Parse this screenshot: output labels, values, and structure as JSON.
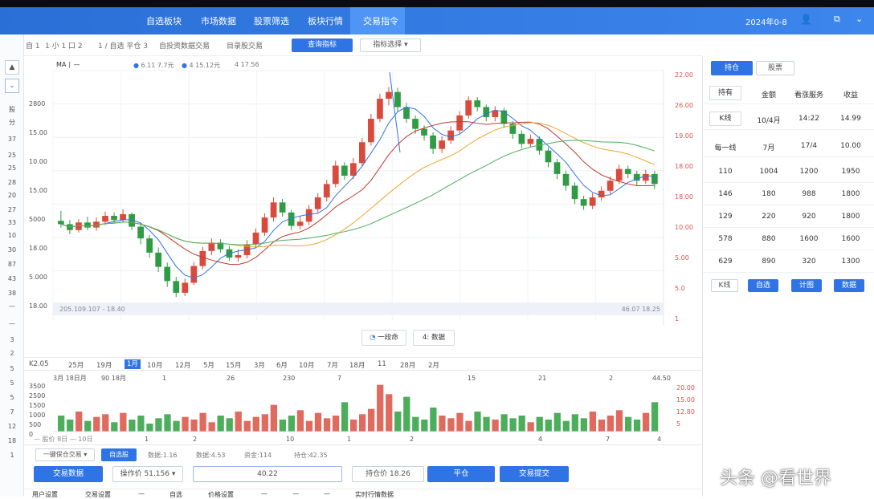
{
  "nav": {
    "items": [
      "自选板块",
      "市场数据",
      "股票筛选",
      "板块行情",
      "交易指令"
    ],
    "active_index": 4,
    "date": "2024年0-8",
    "user_icon": "user-icon",
    "share_icon": "share-icon"
  },
  "toolbar": {
    "crumbs": [
      "自 1",
      "1 小 1 口 2",
      "1 / 自选 平仓 3",
      "自投资数据交易",
      "目录股交易"
    ],
    "primary_btn": "查询指标",
    "dropdown": "指标选择"
  },
  "chart": {
    "legend": [
      "6.11 7.7元",
      "4 15.12元",
      "4 17.56"
    ],
    "legend_colors": [
      "#2f74e4",
      "#d1453b",
      "#f2a431"
    ],
    "left_axis": [
      "2800",
      "15.00",
      "10.00",
      "15.00",
      "5000",
      "18.00",
      "5.000",
      "18.00"
    ],
    "right_axis": [
      "22.00",
      "26.00",
      "19.00",
      "18.00",
      "18.00",
      "10.00",
      "5.00",
      "5.0",
      "1"
    ],
    "info_left": "205.109.107 - 18.40",
    "info_right": "46.07 18.25",
    "btn1": "一段命",
    "btn2": "4: 数据"
  },
  "left_panel": {
    "labels": [
      "股",
      "分",
      "37",
      "25",
      "25",
      "28",
      "20",
      "27",
      "33",
      "10",
      "30",
      "87",
      "43",
      "38",
      "—",
      "—",
      "3",
      "2",
      "5",
      "5",
      "5",
      "7",
      "12",
      "18",
      "1"
    ]
  },
  "periods": [
    "K2.05",
    "25月",
    "19月",
    "1月",
    "10月",
    "12月",
    "5月",
    "15月",
    "3月",
    "6月",
    "10月",
    "7月",
    "18月",
    "11",
    "28月",
    "2月"
  ],
  "period_active": 3,
  "volume": {
    "title": "3月 18日月",
    "marker": "90 18月",
    "top_ticks": [
      "1",
      "26",
      "230",
      "7",
      "15",
      "21",
      "2",
      "44.50"
    ],
    "left_axis": [
      "3500",
      "2500",
      "1500",
      "1000",
      "500",
      "0"
    ],
    "right_axis": [
      "20.00",
      "15.00",
      "12.80",
      "5"
    ],
    "bottom_ticks": [
      "1",
      "2",
      "10",
      "1",
      "2",
      "4",
      "7",
      "4"
    ],
    "legend_text": "— 股价 8日 — 10日"
  },
  "right_panel": {
    "tabs": [
      "持仓",
      "股票"
    ],
    "headers": [
      "持有",
      "金额",
      "看涨服务",
      "收益"
    ],
    "row1": [
      "K线",
      "10/4月",
      "14:22",
      "14.99"
    ],
    "row2": [
      "每一线",
      "7月",
      "17/4",
      "10.00"
    ],
    "rows": [
      [
        "110",
        "1004",
        "1200",
        "1950"
      ],
      [
        "146",
        "180",
        "988",
        "1800"
      ],
      [
        "129",
        "220",
        "920",
        "1800"
      ],
      [
        "578",
        "880",
        "1600",
        "1600"
      ],
      [
        "629",
        "890",
        "320",
        "1300"
      ]
    ],
    "buttons": [
      "K线",
      "自选",
      "计图",
      "数据"
    ]
  },
  "bottom": {
    "select": "一键保仓交易",
    "tag": "自选股",
    "info": [
      "数据:1.16",
      "数据:4.53",
      "资金:114",
      "持仓:42.35"
    ],
    "trade_btn": "交易数据",
    "price_select": "操作价 51.156",
    "amount": "40.22",
    "price_box": "持仓价 18.26",
    "buy_btn": "平仓",
    "submit_btn": "交易提交",
    "footer": [
      "用户设置",
      "交易设置",
      "—",
      "自选",
      "价格设置",
      "—",
      "—",
      "—",
      "实时行情数据"
    ]
  },
  "watermark": "头条 @看世界",
  "chart_data": {
    "type": "candlestick",
    "candles": [
      [
        15,
        14.6,
        16.2,
        14.2
      ],
      [
        14.6,
        13.9,
        15.1,
        13.4
      ],
      [
        13.9,
        14.8,
        15.2,
        13.6
      ],
      [
        14.8,
        14.2,
        15.5,
        13.9
      ],
      [
        14.2,
        14.9,
        15.4,
        13.8
      ],
      [
        14.9,
        15.6,
        16.1,
        14.5
      ],
      [
        15.6,
        15.1,
        16.0,
        14.7
      ],
      [
        15.1,
        15.8,
        16.4,
        14.8
      ],
      [
        15.8,
        14.3,
        16.0,
        13.9
      ],
      [
        14.3,
        12.9,
        14.6,
        12.2
      ],
      [
        12.9,
        11.2,
        13.3,
        10.6
      ],
      [
        11.2,
        9.5,
        11.8,
        8.9
      ],
      [
        9.5,
        7.8,
        10.0,
        7.1
      ],
      [
        7.8,
        6.4,
        8.3,
        5.9
      ],
      [
        6.4,
        7.6,
        8.1,
        6.0
      ],
      [
        7.6,
        9.6,
        10.1,
        7.3
      ],
      [
        9.6,
        11.4,
        11.9,
        9.2
      ],
      [
        11.4,
        12.4,
        12.9,
        10.9
      ],
      [
        12.4,
        11.6,
        12.8,
        11.2
      ],
      [
        11.6,
        10.6,
        12.0,
        10.2
      ],
      [
        10.6,
        10.9,
        11.6,
        10.1
      ],
      [
        10.9,
        12.2,
        12.7,
        10.5
      ],
      [
        12.2,
        13.6,
        14.1,
        11.9
      ],
      [
        13.6,
        15.4,
        15.9,
        13.2
      ],
      [
        15.4,
        17.2,
        17.8,
        14.9
      ],
      [
        17.2,
        16.0,
        17.6,
        15.5
      ],
      [
        16.0,
        14.4,
        16.3,
        13.9
      ],
      [
        14.4,
        14.9,
        15.6,
        14.0
      ],
      [
        14.9,
        16.4,
        16.9,
        14.5
      ],
      [
        16.4,
        17.8,
        18.3,
        16.0
      ],
      [
        17.8,
        19.4,
        19.9,
        17.3
      ],
      [
        19.4,
        21.6,
        22.2,
        19.0
      ],
      [
        21.6,
        20.4,
        22.0,
        19.9
      ],
      [
        20.4,
        21.9,
        22.5,
        20.0
      ],
      [
        21.9,
        24.4,
        24.9,
        21.5
      ],
      [
        24.4,
        27.2,
        27.8,
        24.0
      ],
      [
        27.2,
        29.6,
        30.2,
        26.8
      ],
      [
        29.6,
        30.4,
        31.0,
        28.8
      ],
      [
        30.4,
        28.6,
        30.9,
        28.1
      ],
      [
        28.6,
        27.2,
        29.1,
        26.7
      ],
      [
        27.2,
        26.0,
        27.6,
        25.4
      ],
      [
        26.0,
        25.2,
        26.4,
        24.6
      ],
      [
        25.2,
        23.6,
        25.6,
        23.0
      ],
      [
        23.6,
        24.6,
        25.1,
        23.1
      ],
      [
        24.6,
        25.8,
        26.3,
        24.2
      ],
      [
        25.8,
        27.6,
        28.1,
        25.4
      ],
      [
        27.6,
        29.4,
        29.9,
        27.2
      ],
      [
        29.4,
        28.6,
        29.8,
        28.1
      ],
      [
        28.6,
        27.4,
        28.9,
        26.9
      ],
      [
        27.4,
        28.2,
        28.7,
        26.9
      ],
      [
        28.2,
        26.6,
        28.5,
        26.1
      ],
      [
        26.6,
        25.4,
        26.9,
        24.8
      ],
      [
        25.4,
        24.2,
        25.8,
        23.7
      ],
      [
        24.2,
        24.8,
        25.3,
        23.8
      ],
      [
        24.8,
        23.4,
        25.1,
        22.9
      ],
      [
        23.4,
        22.0,
        23.8,
        21.4
      ],
      [
        22.0,
        20.6,
        22.4,
        20.0
      ],
      [
        20.6,
        19.2,
        21.0,
        18.6
      ],
      [
        19.2,
        17.6,
        19.6,
        17.0
      ],
      [
        17.6,
        16.8,
        18.0,
        16.3
      ],
      [
        16.8,
        17.8,
        18.3,
        16.4
      ],
      [
        17.8,
        18.6,
        19.1,
        17.4
      ],
      [
        18.6,
        19.8,
        20.3,
        18.2
      ],
      [
        19.8,
        21.2,
        21.7,
        19.4
      ],
      [
        21.2,
        20.6,
        21.6,
        20.1
      ],
      [
        20.6,
        19.8,
        21.0,
        19.2
      ],
      [
        19.8,
        20.6,
        21.1,
        19.4
      ],
      [
        20.6,
        19.4,
        21.0,
        18.8
      ]
    ],
    "volumes": [
      1200,
      900,
      1500,
      800,
      1100,
      1300,
      700,
      1400,
      900,
      1200,
      600,
      1000,
      1300,
      800,
      1100,
      900,
      1400,
      700,
      1200,
      1000,
      1500,
      800,
      1100,
      1300,
      2000,
      900,
      1200,
      1600,
      800,
      1400,
      1000,
      1200,
      2200,
      900,
      1300,
      1700,
      3500,
      2800,
      1500,
      2600,
      1100,
      900,
      1800,
      1200,
      1000,
      1400,
      800,
      1500,
      1100,
      900,
      1300,
      1000,
      1200,
      700,
      1100,
      900,
      1400,
      800,
      1300,
      1000,
      1500,
      900,
      1200,
      1600,
      1100,
      900,
      1400,
      2200
    ]
  }
}
